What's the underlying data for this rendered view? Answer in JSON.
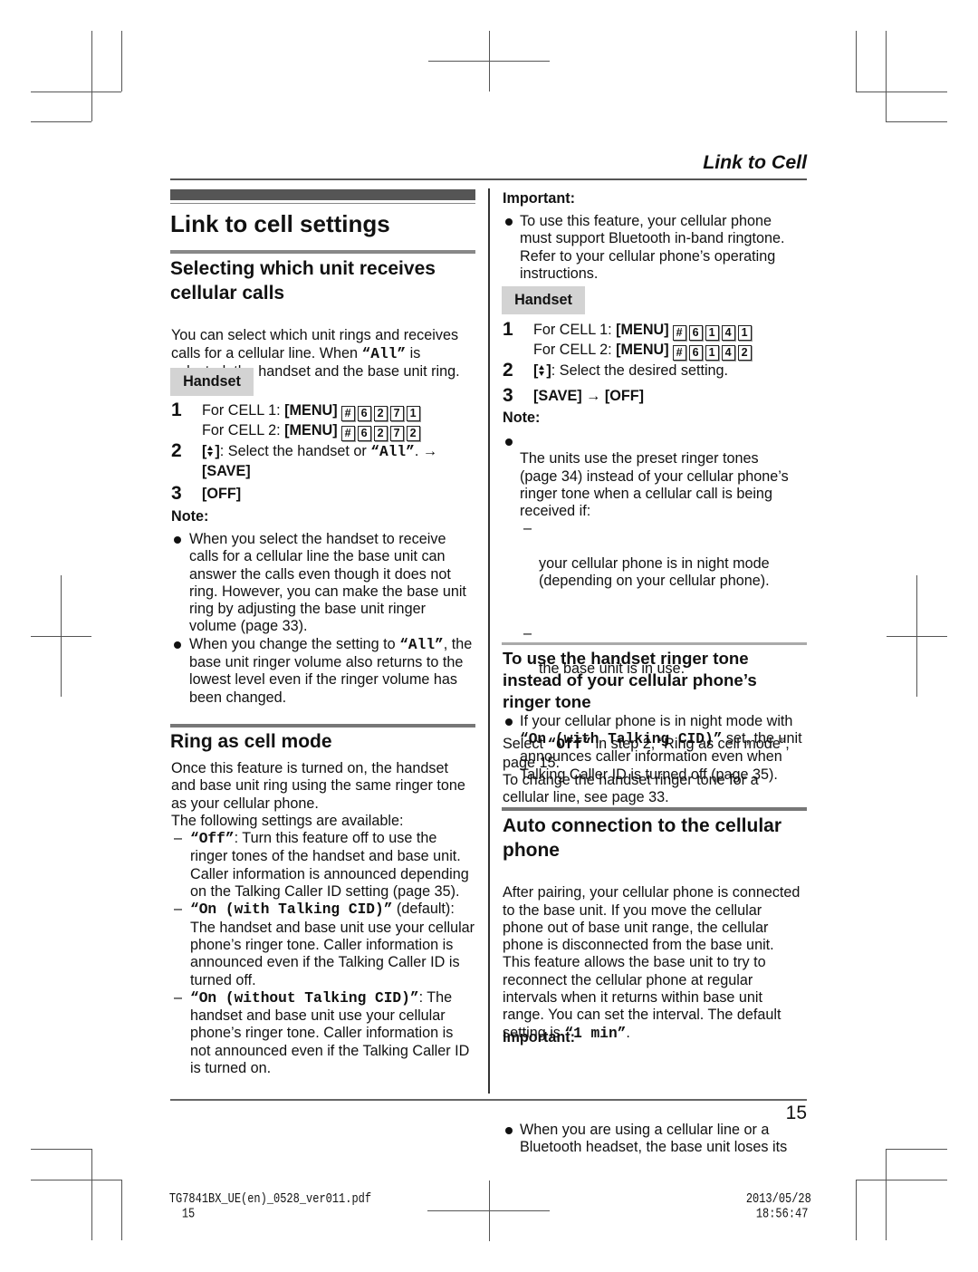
{
  "header": {
    "chapter_title": "Link to Cell"
  },
  "page_title": "Link to cell settings",
  "section_unit": {
    "heading": "Selecting which unit receives\ncellular calls",
    "intro": {
      "t1": "You can select which unit rings and receives\ncalls for a cellular line. When ",
      "m1": "“All”",
      "t2": " is\nselected, the handset and the base unit ring."
    },
    "mode_label": "Handset",
    "step1": {
      "num": "1",
      "cell1_prefix": "For CELL 1: ",
      "cell2_prefix": "For CELL 2: ",
      "menu_key": "[MENU]",
      "cell1_keys": [
        "#",
        "6",
        "2",
        "7",
        "1"
      ],
      "cell2_keys": [
        "#",
        "6",
        "2",
        "7",
        "2"
      ]
    },
    "step2": {
      "num": "2",
      "key_open": "[",
      "key_close": "]",
      "t1": ": Select the handset or ",
      "m1": "“All”",
      "t2": ". →",
      "save_key": "[SAVE]"
    },
    "step3": {
      "num": "3",
      "off_key": "[OFF]"
    },
    "note_label": "Note:",
    "notes": [
      {
        "t1": "When you select the handset to receive\ncalls for a cellular line the base unit can\nanswer the calls even though it does not\nring. However, you can make the base unit\nring by adjusting the base unit ringer\nvolume (page 33)."
      },
      {
        "t1": "When you change the setting to ",
        "m1": "“All”",
        "t2": ", the\nbase unit ringer volume also returns to the\nlowest level even if the ringer volume has\nbeen changed."
      }
    ]
  },
  "section_ring": {
    "heading": "Ring as cell mode",
    "intro": "Once this feature is turned on, the handset\nand base unit ring using the same ringer tone\nas your cellular phone.\nThe following settings are available:",
    "dash_marker": "–",
    "options": [
      {
        "value": "“Off”",
        "desc": ": Turn this feature off to use the\nringer tones of the handset and base unit.\nCaller information is announced depending\non the Talking Caller ID setting (page 35)."
      },
      {
        "value": "“On (with Talking CID)”",
        "desc": " (default):\nThe handset and base unit use your cellular\nphone’s ringer tone. Caller information is\nannounced even if the Talking Caller ID is\nturned off."
      },
      {
        "value": "“On (without Talking CID)”",
        "desc": ": The\nhandset and base unit use your cellular\nphone’s ringer tone. Caller information is\nnot announced even if the Talking Caller ID\nis turned on."
      }
    ],
    "important_label": "Important:",
    "important": "To use this feature, your cellular phone\nmust support Bluetooth in-band ringtone.\nRefer to your cellular phone’s operating\ninstructions.",
    "mode_label": "Handset",
    "step1": {
      "num": "1",
      "cell1_prefix": "For CELL 1: ",
      "cell2_prefix": "For CELL 2: ",
      "menu_key": "[MENU]",
      "cell1_keys": [
        "#",
        "6",
        "1",
        "4",
        "1"
      ],
      "cell2_keys": [
        "#",
        "6",
        "1",
        "4",
        "2"
      ]
    },
    "step2": {
      "num": "2",
      "key_open": "[",
      "key_close": "]",
      "text": ": Select the desired setting."
    },
    "step3": {
      "num": "3",
      "save_key": "[SAVE]",
      "arrow": " → ",
      "off_key": "[OFF]"
    },
    "note_label": "Note:",
    "note1": {
      "text": "The units use the preset ringer tones\n(page 34) instead of your cellular phone’s\nringer tone when a cellular call is being\nreceived if:",
      "sub": [
        "your cellular phone is in night mode\n(depending on your cellular phone).",
        "the base unit is in use."
      ]
    },
    "note2": {
      "t1": "If your cellular phone is in night mode with\n",
      "m1": "“On (with Talking CID)”",
      "t2": " set, the unit\nannounces caller information even when\nTalking Caller ID is turned off (page 35)."
    }
  },
  "section_handset_tone": {
    "heading": "To use the handset ringer tone\ninstead of your cellular phone’s\nringer tone",
    "t1": "Select ",
    "m1": "“Off”",
    "t2": " in step 2, “Ring as cell mode”,\npage 15.\nTo change the handset ringer tone for a\ncellular line, see page 33."
  },
  "section_auto": {
    "heading": "Auto connection to the cellular\nphone",
    "t1": "After pairing, your cellular phone is connected\nto the base unit. If you move the cellular\nphone out of base unit range, the cellular\nphone is disconnected from the base unit.\nThis feature allows the base unit to try to\nreconnect the cellular phone at regular\nintervals when it returns within base unit\nrange. You can set the interval. The default\nsetting is ",
    "m1": "“1 min”",
    "t2": ".",
    "important_label": "Important:",
    "important": "When you are using a cellular line or a\nBluetooth headset, the base unit loses its"
  },
  "page_number": "15",
  "footer": {
    "file_name": "TG7841BX_UE(en)_0528_ver011.pdf",
    "sheet_number": "15",
    "date": "2013/05/28",
    "time": "18:56:47"
  }
}
